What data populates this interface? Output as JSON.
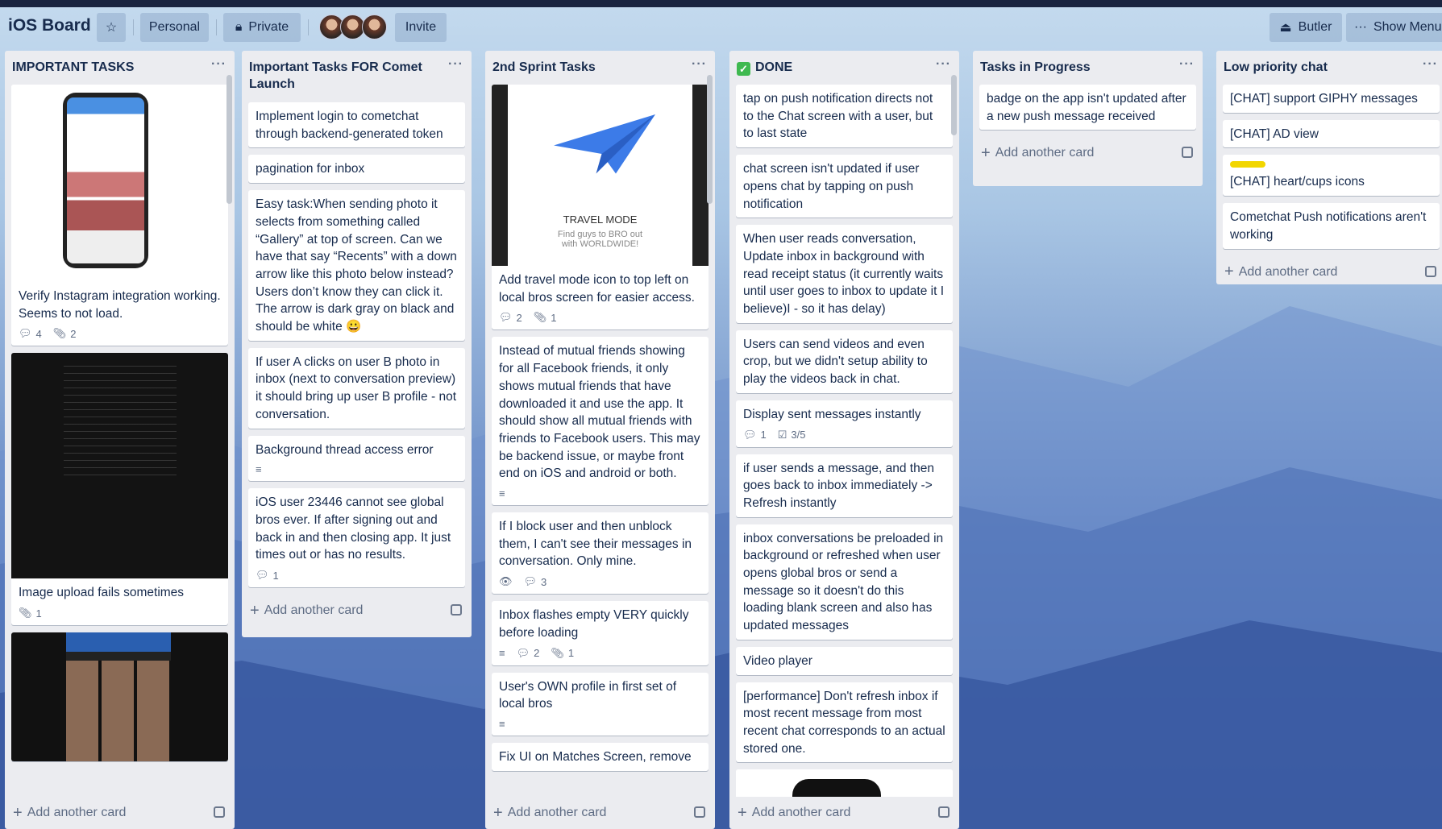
{
  "header": {
    "board_title": "iOS Board",
    "star_icon": "star-icon",
    "personal": "Personal",
    "private": "Private",
    "invite": "Invite",
    "butler": "Butler",
    "show_menu": "Show Menu"
  },
  "add_card_label": "Add another card",
  "lists": [
    {
      "title": "IMPORTANT TASKS",
      "cards": [
        {
          "image": "phone-profile",
          "text": "Verify Instagram integration working. Seems to not load.",
          "badges": [
            {
              "icon": "comment",
              "count": "4"
            },
            {
              "icon": "attachment",
              "count": "2"
            }
          ]
        },
        {
          "image": "email-dark",
          "text": "Image upload fails sometimes",
          "badges": [
            {
              "icon": "attachment",
              "count": "1"
            }
          ]
        },
        {
          "image": "discover-dark",
          "text": "",
          "badges": []
        }
      ]
    },
    {
      "title": "Important Tasks FOR Comet Launch",
      "cards": [
        {
          "text": "Implement login to cometchat through backend-generated token",
          "badges": []
        },
        {
          "text": "pagination for inbox",
          "badges": []
        },
        {
          "text": "Easy task:When sending photo it selects from something called “Gallery” at top of screen. Can we have that say “Recents” with a down arrow like this photo below instead? Users don’t know they can click it. The arrow is dark gray on black and should be white 😀",
          "badges": []
        },
        {
          "text": "If user A clicks on user B photo in inbox (next to conversation preview) it should bring up user B profile - not conversation.",
          "badges": []
        },
        {
          "text": "Background thread access error",
          "badges": [
            {
              "icon": "description",
              "count": ""
            }
          ]
        },
        {
          "text": "iOS user 23446 cannot see global bros ever. If after signing out and back in and then closing app. It just times out or has no results.",
          "badges": [
            {
              "icon": "comment",
              "count": "1"
            }
          ]
        }
      ]
    },
    {
      "title": "2nd Sprint Tasks",
      "cards": [
        {
          "image": "travel-mode",
          "image_title": "TRAVEL MODE",
          "image_sub": "Find guys to BRO out with WORLDWIDE!",
          "text": "Add travel mode icon to top left on local bros screen for easier access.",
          "badges": [
            {
              "icon": "comment",
              "count": "2"
            },
            {
              "icon": "attachment",
              "count": "1"
            }
          ]
        },
        {
          "text": "Instead of mutual friends showing for all Facebook friends, it only shows mutual friends that have downloaded it and use the app. It should show all mutual friends with friends to Facebook users. This may be backend issue, or maybe front end on iOS and android or both.",
          "badges": [
            {
              "icon": "description",
              "count": ""
            }
          ]
        },
        {
          "text": "If I block user and then unblock them, I can't see their messages in conversation. Only mine.",
          "badges": [
            {
              "icon": "watch",
              "count": ""
            },
            {
              "icon": "comment",
              "count": "3"
            }
          ]
        },
        {
          "text": "Inbox flashes empty VERY quickly before loading",
          "badges": [
            {
              "icon": "description",
              "count": ""
            },
            {
              "icon": "comment",
              "count": "2"
            },
            {
              "icon": "attachment",
              "count": "1"
            }
          ]
        },
        {
          "text": "User's OWN profile in first set of local bros",
          "badges": [
            {
              "icon": "description",
              "count": ""
            }
          ]
        },
        {
          "text": "Fix UI on Matches Screen, remove",
          "badges": []
        }
      ]
    },
    {
      "title": "DONE",
      "cards": [
        {
          "text": "tap on push notification directs not to the Chat screen with a user, but to last state",
          "badges": []
        },
        {
          "text": "chat screen isn't updated if user opens chat by tapping on push notification",
          "badges": []
        },
        {
          "text": "When user reads conversation, Update inbox in background with read receipt status (it currently waits until user goes to inbox to update it I believe)I - so it has delay)",
          "badges": []
        },
        {
          "text": "Users can send videos and even crop, but we didn't setup ability to play the videos back in chat.",
          "badges": []
        },
        {
          "text": "Display sent messages instantly",
          "badges": [
            {
              "icon": "comment",
              "count": "1"
            },
            {
              "icon": "checklist",
              "count": "3/5"
            }
          ]
        },
        {
          "text": "if user sends a message, and then goes back to inbox immediately -> Refresh instantly",
          "badges": []
        },
        {
          "text": "inbox conversations be preloaded in background or refreshed when user opens global bros or send a message so it doesn't do this loading blank screen and also has updated messages",
          "badges": []
        },
        {
          "text": "Video player",
          "badges": []
        },
        {
          "text": "[performance] Don't refresh inbox if most recent message from most recent chat corresponds to an actual stored one.",
          "badges": []
        },
        {
          "image": "phone-top",
          "text": "",
          "badges": []
        }
      ]
    },
    {
      "title": "Tasks in Progress",
      "cards": [
        {
          "text": "badge on the app isn't updated after a new push message received",
          "badges": []
        }
      ]
    },
    {
      "title": "Low priority chat",
      "cards": [
        {
          "text": "[CHAT] support GIPHY messages",
          "badges": []
        },
        {
          "text": "[CHAT] AD view",
          "badges": []
        },
        {
          "label": "#f2d600",
          "text": "[CHAT] heart/cups icons",
          "badges": []
        },
        {
          "text": "Cometchat Push notifications aren't working",
          "badges": []
        }
      ]
    }
  ]
}
